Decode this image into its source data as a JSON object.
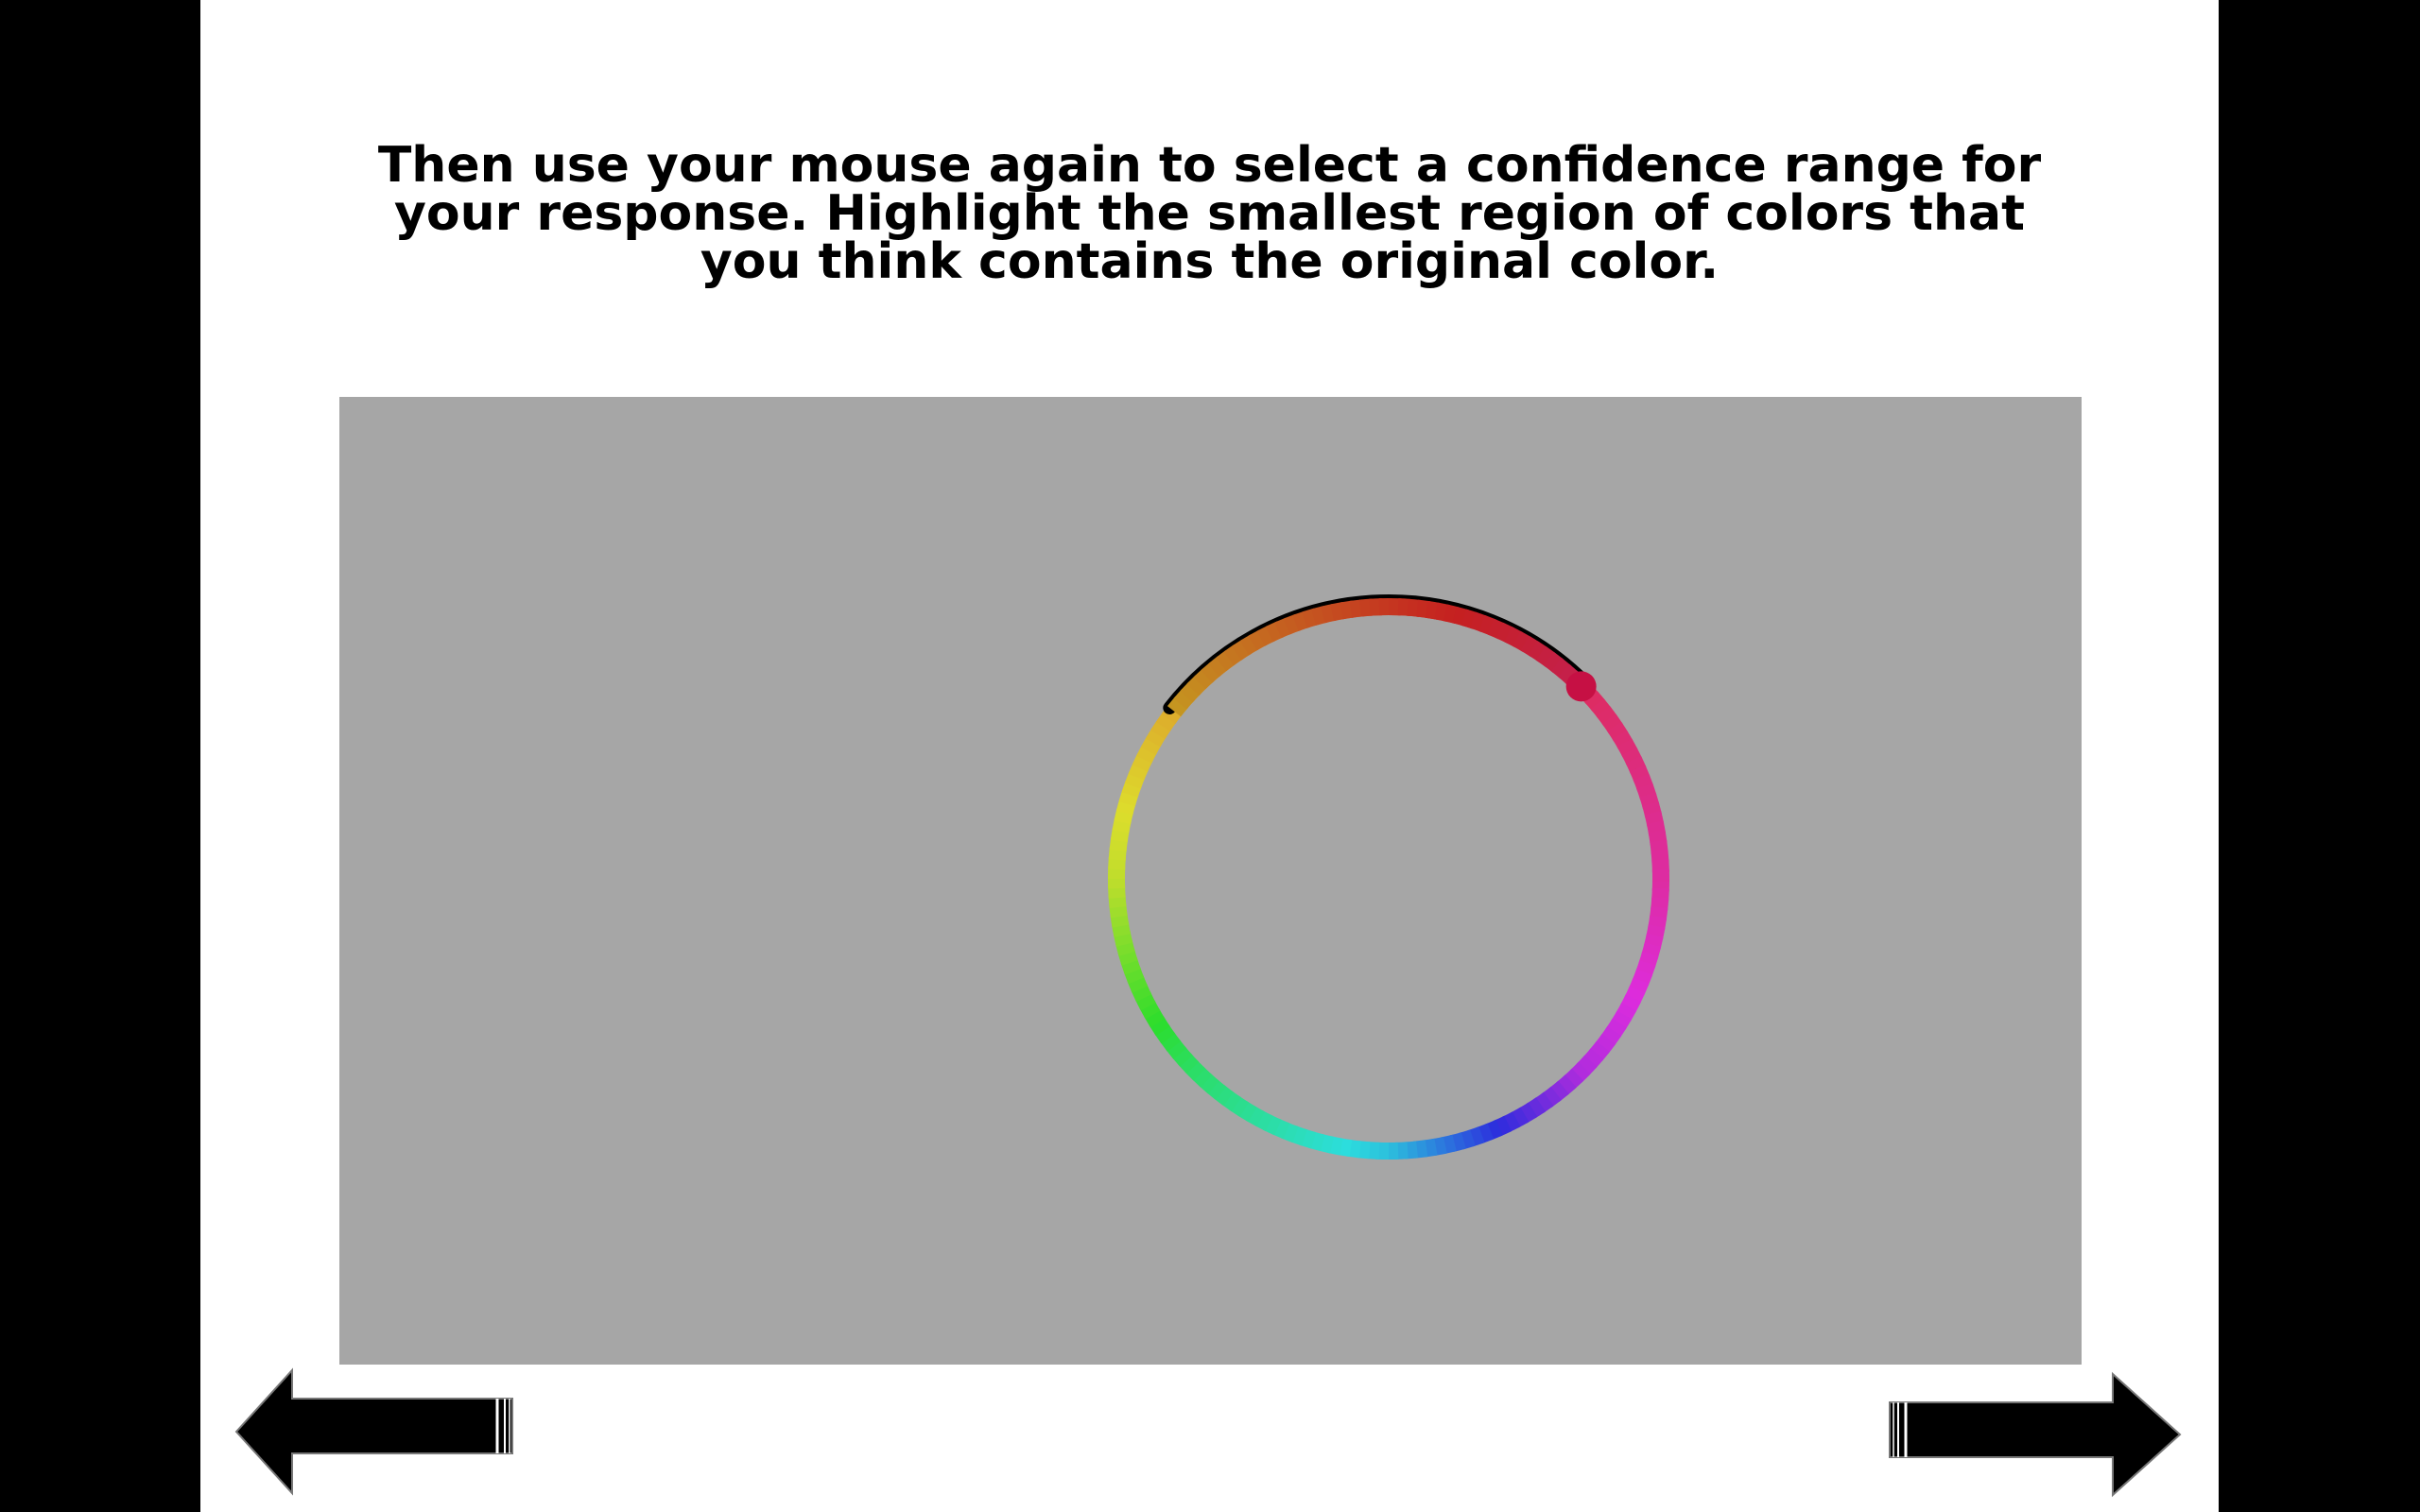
{
  "instructions": {
    "lines": [
      "Then use your mouse again to select a confidence range for",
      "your response. Highlight the smallest region of colors that",
      "you think contains the original color."
    ]
  },
  "colors": {
    "page_background": "#000000",
    "stage_background": "#ffffff",
    "panel_background": "#a6a6a6",
    "selection_outline": "#000000",
    "arrow_fill": "#000000"
  },
  "color_wheel": {
    "confidence_range_start_deg": 218,
    "confidence_range_end_deg": 315,
    "selected_point_deg": 315
  },
  "icons": {
    "back": "left-arrow-icon",
    "next": "right-arrow-icon"
  }
}
